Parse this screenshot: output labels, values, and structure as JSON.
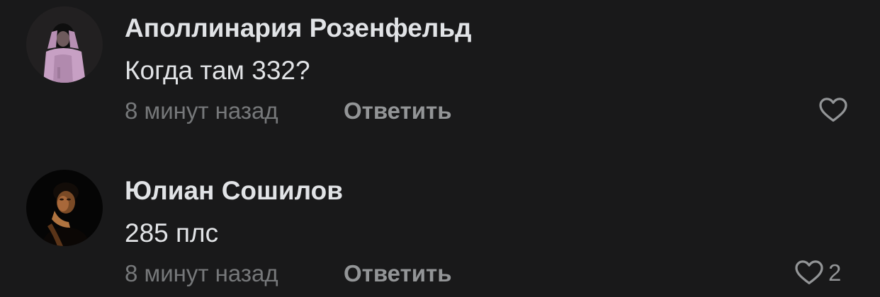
{
  "comments": [
    {
      "author": "Аполлинария Розенфельд",
      "text": "Когда там 332?",
      "time": "8 минут назад",
      "reply_label": "Ответить",
      "like_icon": "heart-outline-icon",
      "like_count": ""
    },
    {
      "author": "Юлиан Сошилов",
      "text": "285 плс",
      "time": "8 минут назад",
      "reply_label": "Ответить",
      "like_icon": "heart-outline-icon",
      "like_count": "2"
    }
  ],
  "colors": {
    "background": "#19191a",
    "primary_text": "#e1e3e6",
    "secondary_text": "#76787a",
    "action_text": "#939597"
  }
}
